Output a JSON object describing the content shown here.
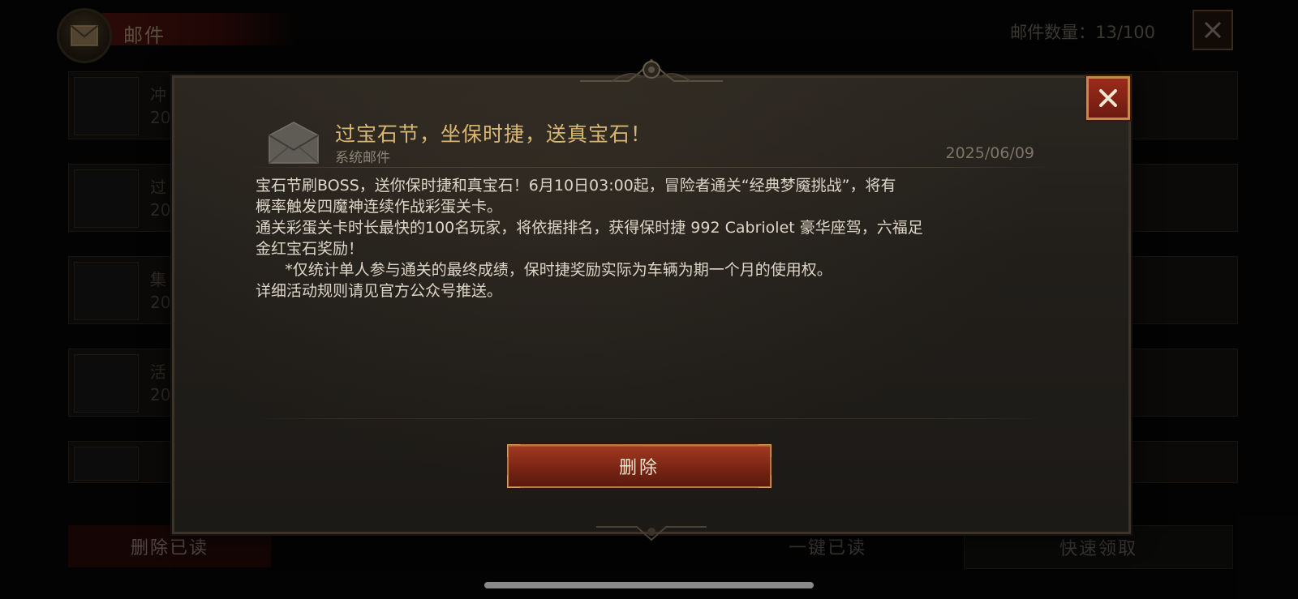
{
  "background": {
    "header_title": "邮件",
    "mail_count": "邮件数量：13/100",
    "list_items": [
      {
        "line1": "冲",
        "line2": "20"
      },
      {
        "line1": "过",
        "line2": "20"
      },
      {
        "line1": "集",
        "line2": "20"
      },
      {
        "line1": "活",
        "line2": "20"
      },
      {
        "line1": "",
        "line2": ""
      }
    ],
    "bottom_buttons": {
      "delete_read": "删除已读",
      "mark_all_read": "一键已读",
      "quick_claim": "快速领取"
    }
  },
  "modal": {
    "title": "过宝石节，坐保时捷，送真宝石！",
    "sender": "系统邮件",
    "date": "2025/06/09",
    "body": [
      "宝石节刷BOSS，送你保时捷和真宝石！6月10日03:00起，冒险者通关“经典梦魇挑战”，将有",
      "概率触发四魔神连续作战彩蛋关卡。",
      "通关彩蛋关卡时长最快的100名玩家，将依据排名，获得保时捷 992 Cabriolet 豪华座驾，六福足",
      "金红宝石奖励！",
      "      *仅统计单人参与通关的最终成绩，保时捷奖励实际为车辆为期一个月的使用权。",
      "详细活动规则请见官方公众号推送。"
    ],
    "delete_label": "删除"
  },
  "colors": {
    "title_gold": "#d9b772",
    "button_red": "#7a2514",
    "close_red": "#9a2b1b"
  },
  "icons": {
    "mail": "envelope-icon",
    "close": "close-icon"
  }
}
